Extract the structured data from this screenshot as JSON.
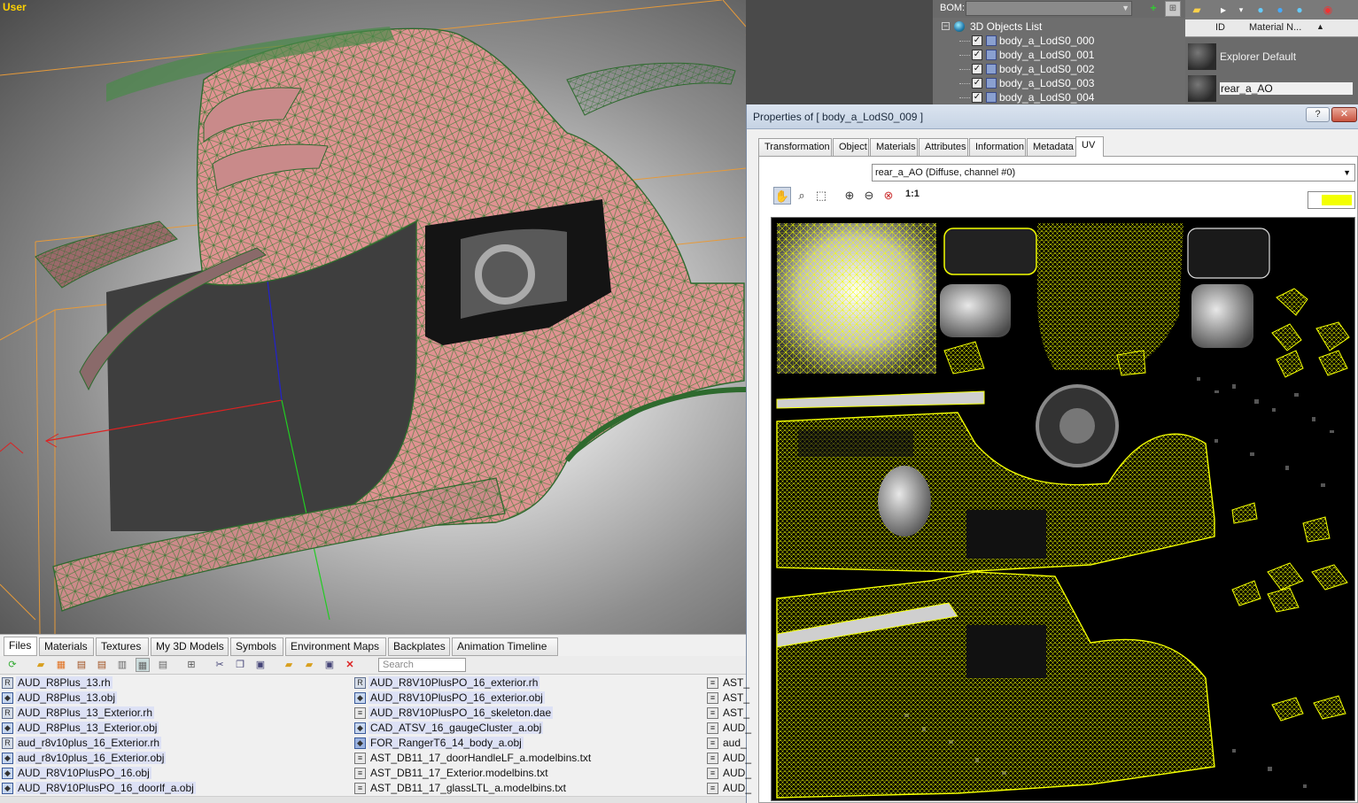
{
  "viewport": {
    "label": "User"
  },
  "scene": {
    "bom_label": "BOM:",
    "tree_root": "3D Objects List",
    "objects": [
      "body_a_LodS0_000",
      "body_a_LodS0_001",
      "body_a_LodS0_002",
      "body_a_LodS0_003",
      "body_a_LodS0_004"
    ]
  },
  "materials": {
    "col_id": "ID",
    "col_name": "Material N...",
    "items": [
      "Explorer Default",
      "rear_a_AO"
    ]
  },
  "properties": {
    "title": "Properties of  [ body_a_LodS0_009 ]",
    "help_btn": "?",
    "close_btn": "✕",
    "tabs": [
      "Transformation",
      "Object",
      "Materials",
      "Attributes",
      "Information",
      "Metadata",
      "UV"
    ],
    "uv_channel": "rear_a_AO (Diffuse, channel #0)",
    "zoom_label": "1:1",
    "wire_color": "#f3ff00"
  },
  "browser": {
    "tabs": [
      "Files",
      "Materials",
      "Textures",
      "My 3D Models",
      "Symbols",
      "Environment Maps",
      "Backplates",
      "Animation Timeline"
    ],
    "search_placeholder": "Search",
    "col1": [
      "AUD_R8Plus_13.rh",
      "AUD_R8Plus_13.obj",
      "AUD_R8Plus_13_Exterior.rh",
      "AUD_R8Plus_13_Exterior.obj",
      "aud_r8v10plus_16_Exterior.rh",
      "aud_r8v10plus_16_Exterior.obj",
      "AUD_R8V10PlusPO_16.obj",
      "AUD_R8V10PlusPO_16_doorlf_a.obj"
    ],
    "col2": [
      "AUD_R8V10PlusPO_16_exterior.rh",
      "AUD_R8V10PlusPO_16_exterior.obj",
      "AUD_R8V10PlusPO_16_skeleton.dae",
      "CAD_ATSV_16_gaugeCluster_a.obj",
      "FOR_RangerT6_14_body_a.obj",
      "AST_DB11_17_doorHandleLF_a.modelbins.txt",
      "AST_DB11_17_Exterior.modelbins.txt",
      "AST_DB11_17_glassLTL_a.modelbins.txt"
    ],
    "col3": [
      "AST_",
      "AST_",
      "AST_",
      "AUD_",
      "aud_",
      "AUD_",
      "AUD_",
      "AUD_"
    ]
  }
}
